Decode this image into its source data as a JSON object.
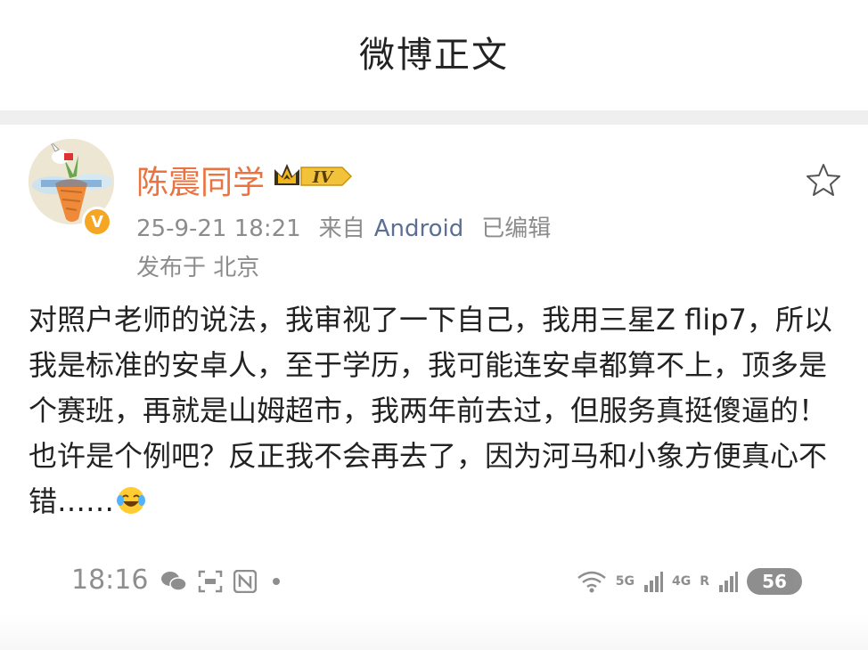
{
  "navbar": {
    "title": "微博正文"
  },
  "post": {
    "author": {
      "name": "陈震同学",
      "level_badge": "IV",
      "verified_badge": "V"
    },
    "meta": {
      "time": "25-9-21 18:21",
      "from_label": "来自",
      "device": "Android",
      "edited": "已编辑"
    },
    "location": "发布于 北京",
    "body": "对照户老师的说法，我审视了一下自己，我用三星Z flip7，所以我是标准的安卓人，至于学历，我可能连安卓都算不上，顶多是个赛班，再就是山姆超市，我两年前去过，但服务真挺傻逼的！也许是个例吧？反正我不会再去了，因为河马和小象方便真心不错……",
    "emoji": "laugh-cry-emoji"
  },
  "embedded_status_bar": {
    "time": "18:16",
    "signal_1": "5G",
    "signal_2": "4G",
    "roaming": "R",
    "battery": "56"
  },
  "colors": {
    "username": "#eb7340",
    "device_link": "#5b6f94",
    "meta_gray": "#8c8c8c",
    "level_gold": "#f2b51a"
  }
}
